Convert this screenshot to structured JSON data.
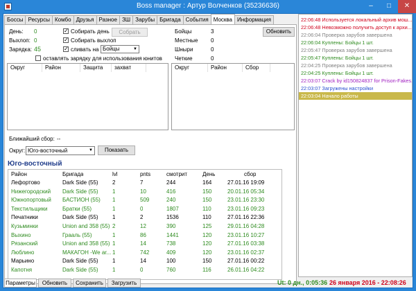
{
  "window": {
    "title": "Boss manager : Артур Волченков (35236636)"
  },
  "tabs": [
    "Боссы",
    "Ресурсы",
    "Комбо",
    "Друзья",
    "Разное",
    "ЗШ",
    "Зарубы",
    "Бригада",
    "События",
    "Москва",
    "Информация"
  ],
  "active_tab": "Москва",
  "stats": {
    "day_label": "День:",
    "day_value": "0",
    "exit_label": "Выхлоп:",
    "exit_value": "0",
    "charge_label": "Зарядка:",
    "charge_value": "45"
  },
  "options": {
    "collect_day": "Собирать день",
    "collect_exit": "Собирать выхлоп",
    "merge_on": "сливать на",
    "merge_target": "Бойцы",
    "keep_charge": "оставлять зарядку для использования юнитов"
  },
  "collect_button": "Собрать",
  "units": [
    {
      "label": "Бойцы",
      "value": "3"
    },
    {
      "label": "Местные",
      "value": "0"
    },
    {
      "label": "Шныри",
      "value": "0"
    },
    {
      "label": "Четкие",
      "value": "0"
    }
  ],
  "refresh_button": "Обновить",
  "left_grid_headers": [
    "Округ",
    "Район",
    "Защита",
    "захват"
  ],
  "right_grid_headers": [
    "Округ",
    "Район",
    "Сбор"
  ],
  "nearest_label": "Ближайший сбор:",
  "nearest_value": "--",
  "district_label": "Округ:",
  "district_value": "Юго-восточный",
  "show_button": "Показать",
  "section_title": "Юго-восточный",
  "table": {
    "headers": [
      "Район",
      "Бригада",
      "lvl",
      "pnts",
      "смотрит",
      "День",
      "сбор"
    ],
    "rows": [
      {
        "c": [
          "Лефортово",
          "Dark Side (55)",
          "2",
          "7",
          "244",
          "164",
          "27.01.16 19:09"
        ],
        "green": false
      },
      {
        "c": [
          "Нижегородский",
          "Dark Side (55)",
          "1",
          "10",
          "416",
          "150",
          "20.01.16 05:34"
        ],
        "green": true
      },
      {
        "c": [
          "Южнопортовый",
          "БАСТИОН (55)",
          "1",
          "509",
          "240",
          "150",
          "23.01.16 23:30"
        ],
        "green": true
      },
      {
        "c": [
          "Текстильщики",
          "Братки (55)",
          "1",
          "0",
          "1807",
          "110",
          "23.01.16 09:23"
        ],
        "green": true
      },
      {
        "c": [
          "Печатники",
          "Dark Side (55)",
          "1",
          "2",
          "1536",
          "110",
          "27.01.16 22:36"
        ],
        "green": false
      },
      {
        "c": [
          "Кузьминки",
          "Union and 358 (55)",
          "2",
          "12",
          "390",
          "125",
          "29.01.16 04:28"
        ],
        "green": true
      },
      {
        "c": [
          "Выхино",
          "Грааль (55)",
          "1",
          "86",
          "1441",
          "120",
          "23.01.16 10:27"
        ],
        "green": true
      },
      {
        "c": [
          "Рязанский",
          "Union and 358 (55)",
          "1",
          "14",
          "738",
          "120",
          "27.01.16 03:38"
        ],
        "green": true
      },
      {
        "c": [
          "Люблино",
          "МАКАГОН -We ar...",
          "1",
          "742",
          "409",
          "120",
          "23.01.16 02:37"
        ],
        "green": true
      },
      {
        "c": [
          "Марьино",
          "Dark Side (55)",
          "1",
          "14",
          "100",
          "150",
          "27.01.16 00:22"
        ],
        "green": false
      },
      {
        "c": [
          "Капотня",
          "Dark Side (55)",
          "1",
          "0",
          "760",
          "116",
          "26.01.16 04:22"
        ],
        "green": true
      }
    ]
  },
  "bottom_buttons": [
    "Параметры",
    "Обновить",
    "Сохранить",
    "Загрузить"
  ],
  "status": {
    "uptime": "Ut: 0 дн., 0:05:36",
    "date": "26 января 2016 - 22:08:26"
  },
  "log": [
    {
      "text": "22:06:48 Используется локальный архив мош...",
      "color": "#d0021b",
      "bg": ""
    },
    {
      "text": "22:06:48 Невозможно получить доступ к архи...",
      "color": "#d0021b",
      "bg": ""
    },
    {
      "text": "22:06:04 Проверка зарубов завершена",
      "color": "#808080",
      "bg": ""
    },
    {
      "text": "22:06:04 Куплены: Бойцы 1 шт.",
      "color": "#2e8b1f",
      "bg": ""
    },
    {
      "text": "22:05:47 Проверка зарубов завершена",
      "color": "#808080",
      "bg": ""
    },
    {
      "text": "22:05:47 Куплены: Бойцы 1 шт.",
      "color": "#2e8b1f",
      "bg": ""
    },
    {
      "text": "22:04:25 Проверка зарубов завершена",
      "color": "#808080",
      "bg": ""
    },
    {
      "text": "22:04:25 Куплены: Бойцы 1 шт.",
      "color": "#2e8b1f",
      "bg": ""
    },
    {
      "text": "22:03:07 Crack by id150824837 for Prison-Fakes.ru",
      "color": "#a020c0",
      "bg": ""
    },
    {
      "text": "22:03:07 Загружены настройки",
      "color": "#2a4fd0",
      "bg": ""
    },
    {
      "text": "22:03:04 Начало работы",
      "color": "#ffffff",
      "bg": "#c9b84a"
    }
  ],
  "colors": {
    "accent": "#2a86d8",
    "green": "#2e8b1f",
    "status_red": "#d0021b"
  }
}
